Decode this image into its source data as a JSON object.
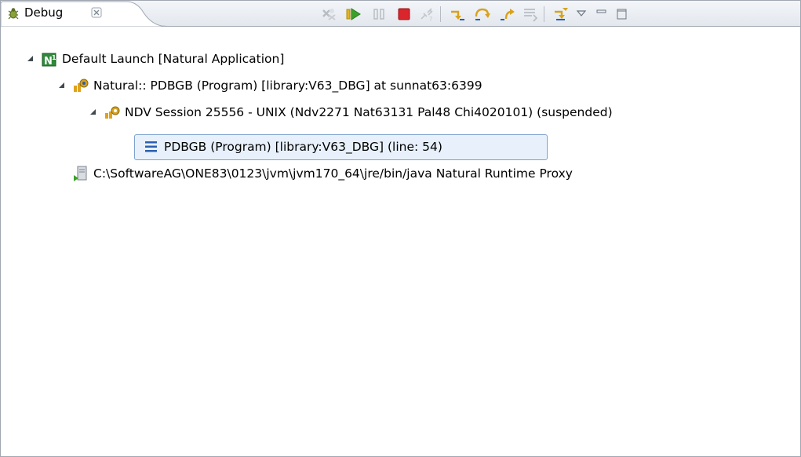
{
  "view": {
    "tab_title": "Debug",
    "tab_icon": "bug-icon",
    "toolbar": [
      {
        "name": "remove-terminated-icon",
        "enabled": false
      },
      {
        "name": "resume-icon",
        "enabled": true
      },
      {
        "name": "suspend-icon",
        "enabled": false
      },
      {
        "name": "terminate-icon",
        "enabled": true
      },
      {
        "name": "disconnect-icon",
        "enabled": false
      },
      {
        "name": "step-into-icon",
        "enabled": true
      },
      {
        "name": "step-over-icon",
        "enabled": true
      },
      {
        "name": "step-return-icon",
        "enabled": true
      },
      {
        "name": "drop-to-frame-icon",
        "enabled": false
      },
      {
        "name": "use-step-filters-icon",
        "enabled": true
      },
      {
        "name": "view-menu-icon",
        "enabled": true
      },
      {
        "name": "minimize-icon",
        "enabled": true
      },
      {
        "name": "maximize-icon",
        "enabled": true
      }
    ]
  },
  "tree": {
    "launch": "Default Launch [Natural Application]",
    "program": "Natural:: PDBGB (Program) [library:V63_DBG] at sunnat63:6399",
    "session": "NDV Session 25556 - UNIX (Ndv2271 Nat63131 Pal48 Chi4020101) (suspended)",
    "frame": "PDBGB (Program) [library:V63_DBG] (line: 54)",
    "process": "C:\\SoftwareAG\\ONE83\\0123\\jvm\\jvm170_64\\jre/bin/java Natural Runtime Proxy"
  },
  "colors": {
    "accent_blue": "#2a5fb0",
    "terminate_red": "#d9252b",
    "resume_green": "#3ca12a",
    "step_gold": "#d9a21c",
    "selection_bg": "#e8f1fb",
    "selection_border": "#7da2ce"
  }
}
